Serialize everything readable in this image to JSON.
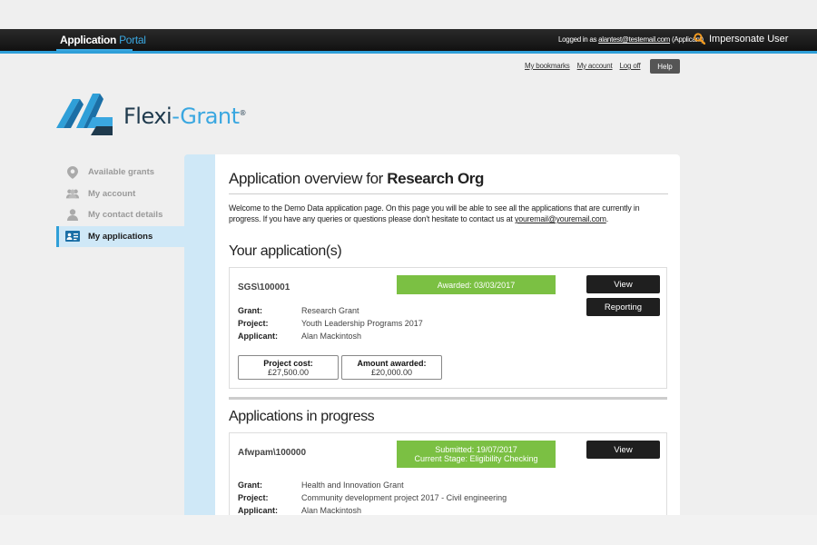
{
  "header": {
    "brand_main": "Application",
    "brand_accent": "Portal",
    "logged_in_prefix": "Logged in as",
    "user_email": "alantest@testemail.com",
    "user_role": "(Applicant)",
    "impersonate_label": "Impersonate User"
  },
  "util": {
    "bookmarks": "My bookmarks",
    "account": "My account",
    "logoff": "Log off",
    "help": "Help"
  },
  "logo": {
    "flexi": "Flexi",
    "dash": "-",
    "grant": "Grant",
    "reg": "®"
  },
  "sidebar": {
    "items": [
      {
        "label": "Available grants",
        "icon": "map-pin-icon"
      },
      {
        "label": "My account",
        "icon": "users-icon"
      },
      {
        "label": "My contact details",
        "icon": "user-icon"
      },
      {
        "label": "My applications",
        "icon": "id-card-icon"
      }
    ]
  },
  "main": {
    "title_prefix": "Application overview for",
    "org_name": "Research Org",
    "welcome_text": "Welcome to the Demo Data application page. On this page you will be able to see all the applications that are currently in progress. If you have any queries or questions please don't hesitate to contact us at",
    "contact_email": "youremail@youremail.com",
    "welcome_end": "."
  },
  "applications": {
    "section_title": "Your application(s)",
    "card": {
      "ref": "SGS\\100001",
      "status": "Awarded: 03/03/2017",
      "view_label": "View",
      "reporting_label": "Reporting",
      "grant_key": "Grant:",
      "grant": "Research Grant",
      "project_key": "Project:",
      "project": "Youth Leadership Programs 2017",
      "applicant_key": "Applicant:",
      "applicant": "Alan Mackintosh",
      "cost_label": "Project cost:",
      "cost_value": "£27,500.00",
      "awarded_label": "Amount awarded:",
      "awarded_value": "£20,000.00"
    }
  },
  "in_progress": {
    "section_title": "Applications in progress",
    "card": {
      "ref": "Afwpam\\100000",
      "status_line1": "Submitted: 19/07/2017",
      "status_line2": "Current Stage: Eligibility Checking",
      "view_label": "View",
      "grant_key": "Grant:",
      "grant": "Health and Innovation Grant",
      "project_key": "Project:",
      "project": "Community development project 2017 - Civil engineering",
      "applicant_key": "Applicant:",
      "applicant": "Alan Mackintosh"
    }
  },
  "colors": {
    "accent_blue": "#2f9fd8",
    "status_green": "#7bc043",
    "topbar": "#1a1a1a",
    "sidebar_active": "#cfe8f7"
  }
}
